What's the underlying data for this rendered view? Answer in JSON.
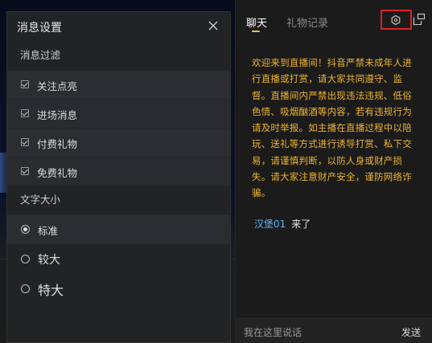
{
  "settings": {
    "title": "消息设置",
    "filter_section": "消息过滤",
    "filters": [
      {
        "label": "关注点亮",
        "checked": true
      },
      {
        "label": "进场消息",
        "checked": true
      },
      {
        "label": "付费礼物",
        "checked": true
      },
      {
        "label": "免费礼物",
        "checked": true
      }
    ],
    "font_section": "文字大小",
    "font_sizes": [
      {
        "label": "标准",
        "selected": true
      },
      {
        "label": "较大",
        "selected": false
      },
      {
        "label": "特大",
        "selected": false
      }
    ]
  },
  "chat": {
    "tabs": [
      "聊天",
      "礼物记录"
    ],
    "active_tab": "聊天",
    "notice": "欢迎来到直播间！抖音严禁未成年人进行直播或打赏，请大家共同遵守、监督。直播间内严禁出现违法违规、低俗色情、吸烟酗酒等内容，若有违规行为请及时举报。如主播在直播过程中以陪玩、送礼等方式进行诱导打赏、私下交易，请谨慎判断，以防人身或财产损失。请大家注意财产安全，谨防网络诈骗。",
    "messages": [
      {
        "user": "汉堡01",
        "text": "来了"
      }
    ],
    "input_placeholder": "我在这里说话",
    "send_label": "发送"
  },
  "colors": {
    "notice": "#f0b530",
    "username": "#57b3f0",
    "tab_indicator": "#f5c531",
    "highlight_box": "#e21e25"
  },
  "icons": {
    "close": "close-icon",
    "settings": "hexagon-settings-icon",
    "popout": "popout-window-icon"
  }
}
